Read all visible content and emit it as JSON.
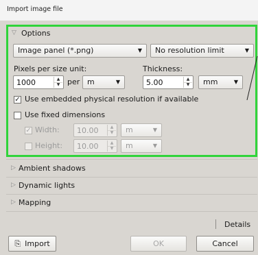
{
  "window": {
    "title": "Import image file"
  },
  "options": {
    "header": "Options",
    "format_select": "Image panel (*.png)",
    "resolution_select": "No resolution limit",
    "pixels_label": "Pixels per size unit:",
    "pixels_value": "1000",
    "per_label": "per",
    "pixels_unit": "m",
    "thickness_label": "Thickness:",
    "thickness_value": "5.00",
    "thickness_unit": "mm",
    "embedded_label": "Use embedded physical resolution if available",
    "embedded_checked": true,
    "fixed_label": "Use fixed dimensions",
    "fixed_checked": false,
    "width_label": "Width:",
    "width_value": "10.00",
    "width_unit": "m",
    "width_checked": true,
    "height_label": "Height:",
    "height_value": "10.00",
    "height_unit": "m",
    "height_checked": false
  },
  "sections": [
    "Ambient shadows",
    "Dynamic lights",
    "Mapping"
  ],
  "footer": {
    "details_label": "Details",
    "import_label": "Import",
    "ok_label": "OK",
    "cancel_label": "Cancel"
  },
  "colors": {
    "highlight_border": "#2fd43a"
  }
}
